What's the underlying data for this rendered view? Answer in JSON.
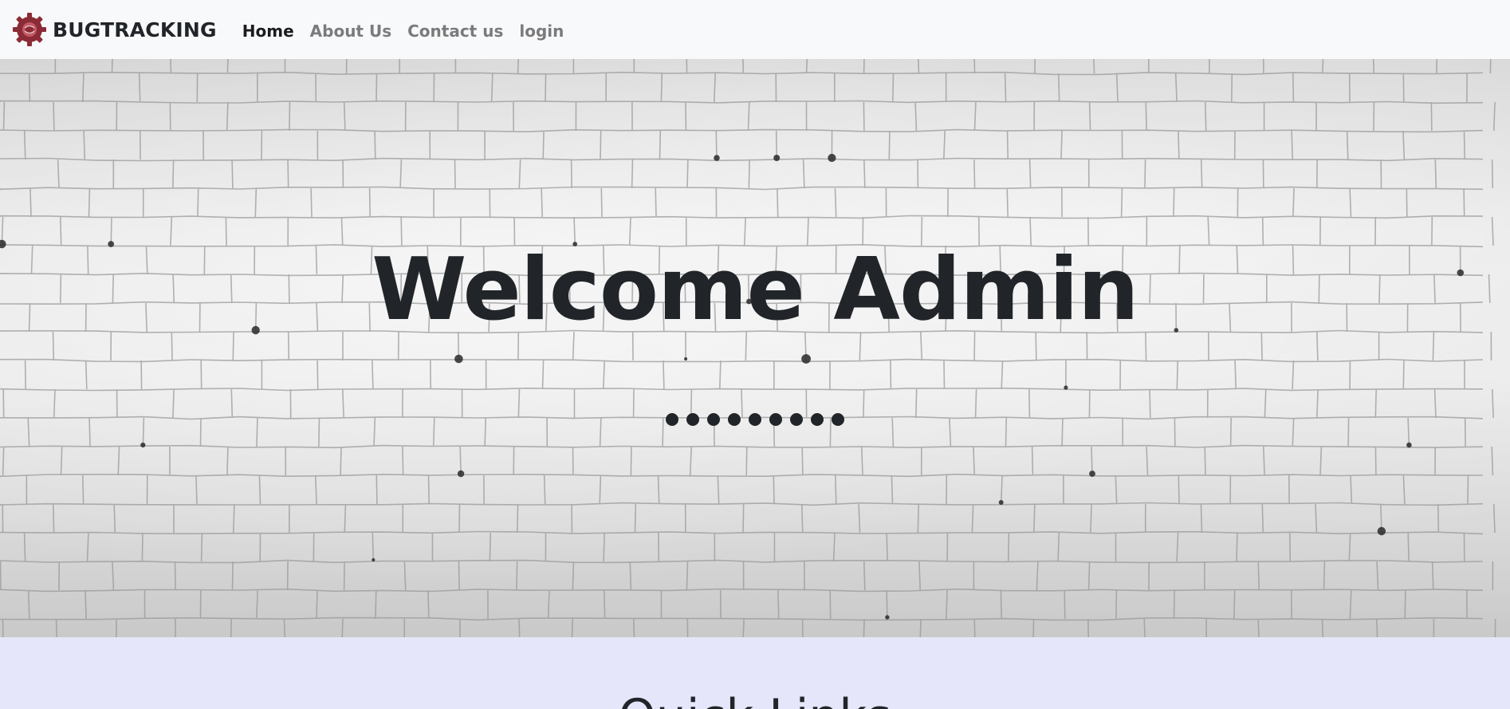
{
  "navbar": {
    "brand_text": "BUGTRACKING",
    "logo_icon": "gear-logo-icon",
    "links": [
      {
        "label": "Home",
        "active": true
      },
      {
        "label": "About Us",
        "active": false
      },
      {
        "label": "Contact us",
        "active": false
      },
      {
        "label": "login",
        "active": false
      }
    ]
  },
  "hero": {
    "title": "Welcome Admin",
    "masked_value": "•••••••••",
    "masked_length": 9,
    "background": "white-brick-wall"
  },
  "lower_section": {
    "heading_partial": "Quick Links"
  },
  "colors": {
    "navbar_bg": "#f8f9fa",
    "brand_logo": "#8b2b35",
    "text_dark": "#212529",
    "nav_muted": "#7b7b7b",
    "lower_bg": "#e6e6fa"
  }
}
